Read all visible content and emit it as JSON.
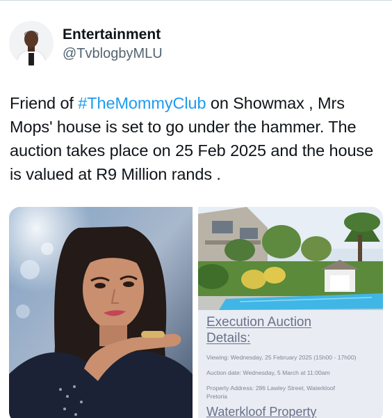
{
  "author": {
    "display_name": "Entertainment",
    "handle": "@TvblogbyMLU"
  },
  "tweet": {
    "text_before": "Friend of ",
    "hashtag": "#TheMommyClub",
    "text_after": " on Showmax , Mrs Mops' house is set to go under the hammer. The auction takes place on 25 Feb 2025 and the house is valued at R9 Million rands ."
  },
  "media": {
    "auction_card": {
      "heading_line1": "Execution Auction",
      "heading_line2": "Details:",
      "viewing": "Viewing: Wednesday, 25 February 2025 (15h00 - 17h00)",
      "auction_date": "Auction date: Wednesday, 5 March at 11:00am",
      "address_line1": "Property Address: 286 Lawley Street, Waterkloof",
      "address_line2": "Pretoria",
      "footer": "Waterkloof Property"
    }
  },
  "colors": {
    "hashtag": "#1d9bf0",
    "text": "#0f1419",
    "handle": "#536471",
    "pool": "#3fb6e6"
  }
}
